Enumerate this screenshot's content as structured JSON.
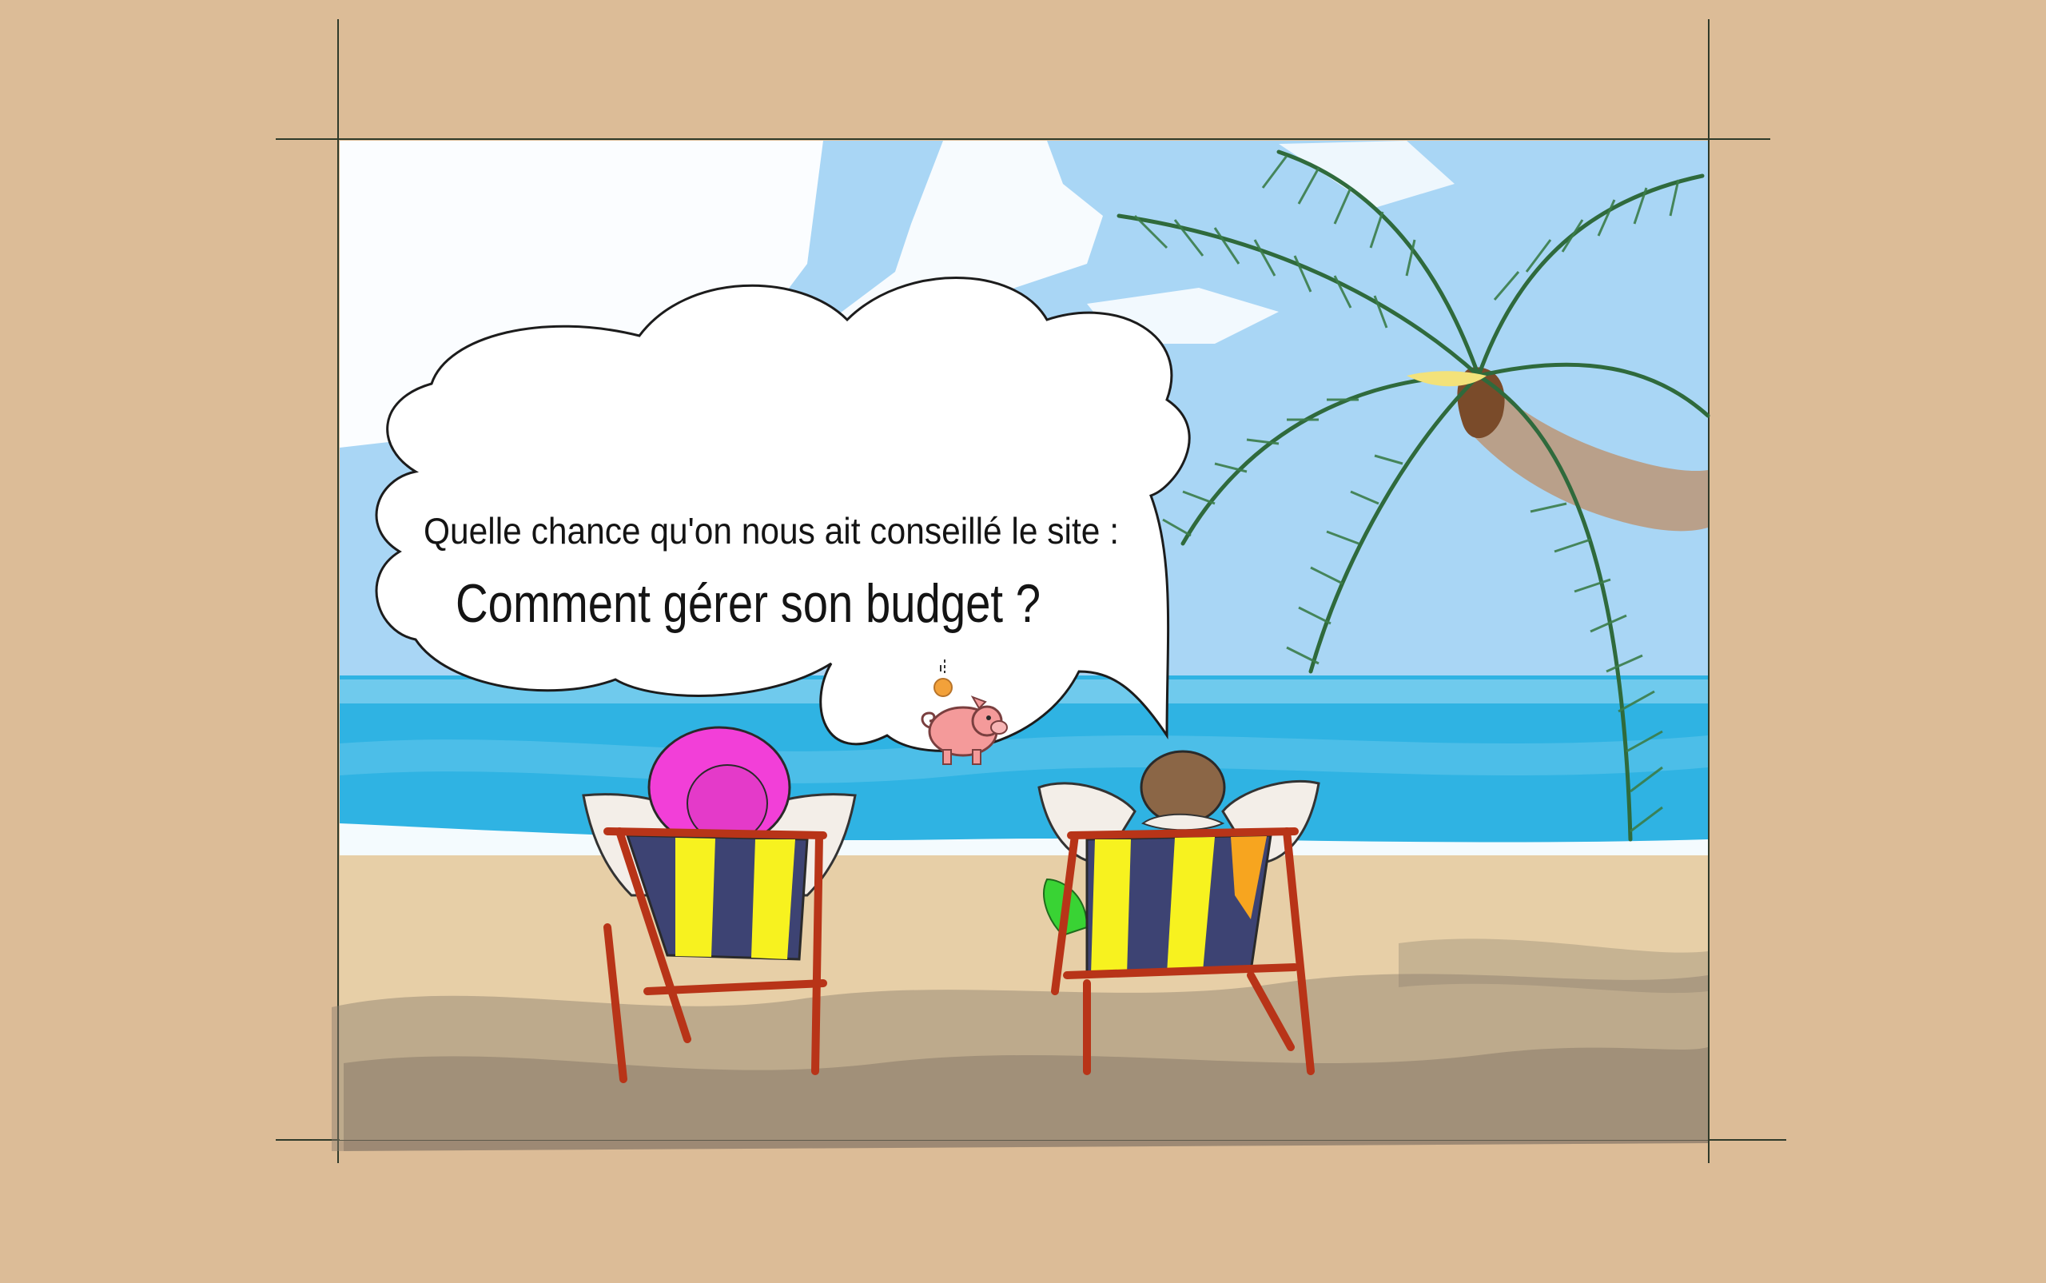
{
  "illustration": {
    "scene": "beach",
    "speech_bubble": {
      "line1": "Quelle chance qu'on nous ait conseillé le site :",
      "line2": "Comment gérer son budget ?"
    },
    "icons": {
      "bubble_icon": "piggy-bank-icon"
    },
    "colors": {
      "background": "#dcbc97",
      "sky": "#a9d6f5",
      "sea": "#2fb3e3",
      "sand": "#e7cfa7",
      "hat": "#f23fd8",
      "chair_frame": "#b83418",
      "chair_stripe_yellow": "#f7f21f",
      "chair_stripe_navy": "#3d4373",
      "palm_leaves": "#3b7d4a",
      "piggy": "#f49a9a",
      "coin": "#f2a13a"
    }
  }
}
